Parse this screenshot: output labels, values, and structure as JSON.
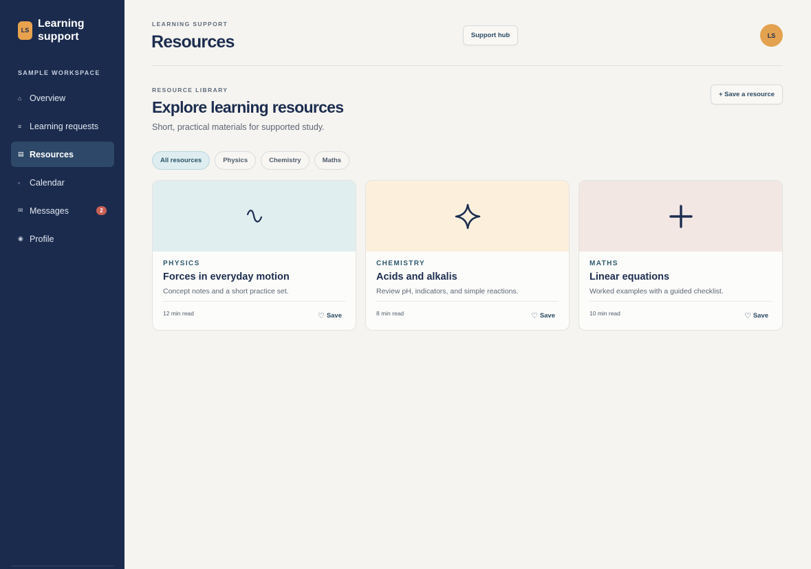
{
  "sidebar": {
    "brand_initials": "LS",
    "brand_title": "Learning support",
    "workspace_label": "SAMPLE WORKSPACE",
    "items": [
      {
        "label": "Overview",
        "icon": "⌂",
        "icon_name": "home-icon"
      },
      {
        "label": "Learning requests",
        "icon": "≡",
        "icon_name": "list-icon"
      },
      {
        "label": "Resources",
        "icon": "▤",
        "icon_name": "book-icon",
        "active": true
      },
      {
        "label": "Calendar",
        "icon": "▫",
        "icon_name": "calendar-icon"
      },
      {
        "label": "Messages",
        "icon": "✉",
        "icon_name": "mail-icon",
        "badge": "2"
      },
      {
        "label": "Profile",
        "icon": "◉",
        "icon_name": "profile-icon"
      }
    ]
  },
  "header": {
    "eyebrow": "LEARNING SUPPORT",
    "title": "Resources",
    "support_hub_label": "Support hub",
    "avatar_initials": "LS"
  },
  "library": {
    "eyebrow": "RESOURCE LIBRARY",
    "title": "Explore learning resources",
    "subtitle": "Short, practical materials for supported study.",
    "save_resource_label": "+ Save a resource"
  },
  "filters": [
    {
      "label": "All resources",
      "active": true
    },
    {
      "label": "Physics"
    },
    {
      "label": "Chemistry"
    },
    {
      "label": "Maths"
    }
  ],
  "cards": [
    {
      "category": "PHYSICS",
      "title": "Forces in everyday motion",
      "description": "Concept notes and a short practice set.",
      "read_time": "12 min read",
      "save_label": "Save",
      "banner_color": "#e1eef0",
      "icon_name": "wave-icon"
    },
    {
      "category": "CHEMISTRY",
      "title": "Acids and alkalis",
      "description": "Review pH, indicators, and simple reactions.",
      "read_time": "8 min read",
      "save_label": "Save",
      "banner_color": "#fcf0dd",
      "icon_name": "sparkle-icon"
    },
    {
      "category": "MATHS",
      "title": "Linear equations",
      "description": "Worked examples with a guided checklist.",
      "read_time": "10 min read",
      "save_label": "Save",
      "banner_color": "#f2e7e3",
      "icon_name": "plus-icon"
    }
  ],
  "colors": {
    "sidebar_bg": "#1a2b4d",
    "accent_orange": "#e3a250",
    "badge_red": "#c95f53",
    "page_bg": "#f5f4f0"
  }
}
